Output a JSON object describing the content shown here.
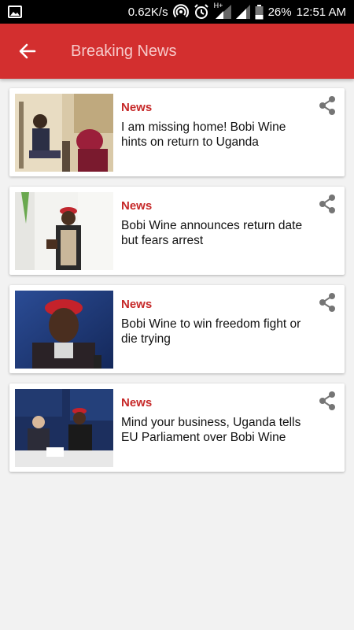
{
  "status_bar": {
    "net_speed": "0.62K/s",
    "network_label": "H+",
    "battery": "26%",
    "time": "12:51 AM",
    "icons": [
      "gallery-icon",
      "hotspot-icon",
      "alarm-icon",
      "signal-icon",
      "signal-icon",
      "battery-icon"
    ]
  },
  "toolbar": {
    "title": "Breaking News",
    "back_icon": "back-arrow-icon",
    "color": "#d32f2f"
  },
  "articles": [
    {
      "category": "News",
      "headline": "I am missing home! Bobi Wine hints on return to Uganda",
      "share_icon": "share-icon"
    },
    {
      "category": "News",
      "headline": "Bobi Wine announces return date but fears arrest",
      "share_icon": "share-icon"
    },
    {
      "category": "News",
      "headline": "Bobi Wine to win freedom fight or die trying",
      "share_icon": "share-icon"
    },
    {
      "category": "News",
      "headline": "Mind your business, Uganda tells EU Parliament over Bobi Wine",
      "share_icon": "share-icon"
    }
  ],
  "colors": {
    "accent": "#d32f2f",
    "category": "#c62828",
    "background": "#f2f2f2"
  }
}
